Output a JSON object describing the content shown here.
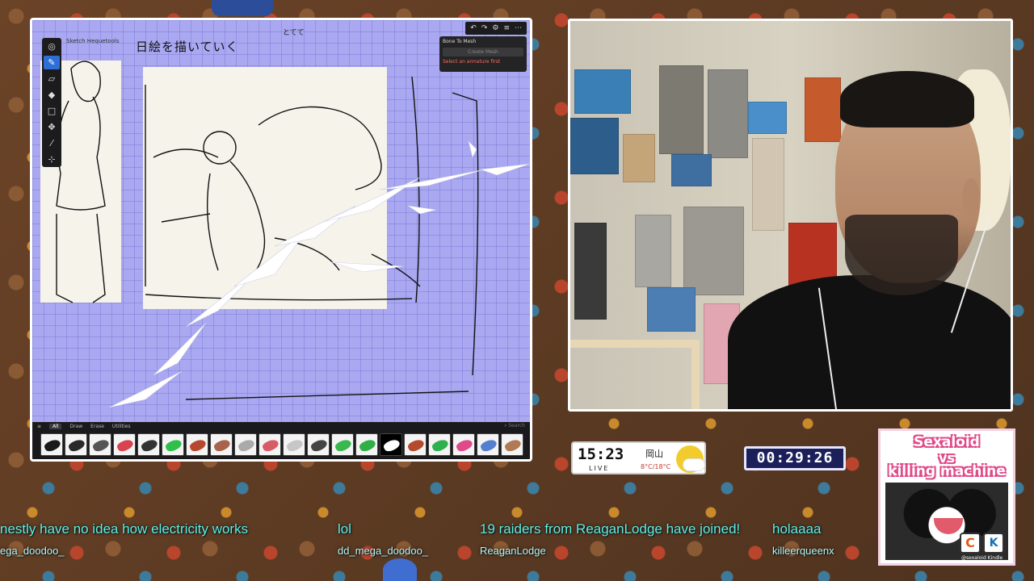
{
  "art_app": {
    "handwritten_note": "日絵を描いていく",
    "handwritten_small": "とてて",
    "tool_hint": "Sketch Hequetools",
    "top_icons": [
      "undo-icon",
      "redo-icon",
      "settings-icon",
      "layers-icon",
      "more-icon"
    ],
    "bone_panel": {
      "title": "Bone To Mesh",
      "button": "Create Mesh",
      "warning": "Select an armature first"
    },
    "brush_tabs": [
      "All",
      "Draw",
      "Erase",
      "Utilities"
    ],
    "brush_tab_active": "All",
    "search_placeholder": "Search",
    "brushes": [
      {
        "name": "ink-brush",
        "color": "#1a1a1a"
      },
      {
        "name": "ink-brush-2",
        "color": "#2a2a2a"
      },
      {
        "name": "pencil-brush",
        "color": "#555555"
      },
      {
        "name": "red-brush",
        "color": "#d9434f"
      },
      {
        "name": "charcoal-brush",
        "color": "#333333"
      },
      {
        "name": "green-brush",
        "color": "#2fbf4a"
      },
      {
        "name": "rust-brush",
        "color": "#b5482e"
      },
      {
        "name": "brown-brush",
        "color": "#a8644a"
      },
      {
        "name": "grey-brush",
        "color": "#aaaaaa"
      },
      {
        "name": "pink-red-brush",
        "color": "#d95b68"
      },
      {
        "name": "light-brush",
        "color": "#c7c7c7"
      },
      {
        "name": "hatch-brush",
        "color": "#444444"
      },
      {
        "name": "green-brush-2",
        "color": "#39b84f"
      },
      {
        "name": "green-brush-3",
        "color": "#2faf46"
      },
      {
        "name": "splatter-brush",
        "color": "#ffffff"
      },
      {
        "name": "rust-brush-2",
        "color": "#b44a2e"
      },
      {
        "name": "green-brush-4",
        "color": "#2fb04e"
      },
      {
        "name": "pink-brush",
        "color": "#e04a8a"
      },
      {
        "name": "blue-brush",
        "color": "#5580d0"
      },
      {
        "name": "tan-brush",
        "color": "#b07a56"
      }
    ]
  },
  "clock": {
    "time": "15:23",
    "live": "LIVE",
    "city": "岡山",
    "temp_low": "8°C",
    "temp_sep": "/",
    "temp_high": "18°C",
    "weather_icon": "sun-cloud-icon"
  },
  "timer": "00:29:26",
  "promo": {
    "title_1": "Sexaloid",
    "vs": "vs",
    "title_2": "killing machine",
    "logo_c": "C",
    "logo_k": "K",
    "caption": "@sexaloid Kindle"
  },
  "chat": [
    {
      "text": "nestly have no idea how electricity works",
      "user": "ega_doodoo_"
    },
    {
      "text": "lol",
      "user": "dd_mega_doodoo_"
    },
    {
      "text": "19 raiders from ReaganLodge have joined!",
      "user": "ReaganLodge"
    },
    {
      "text": "holaaaa",
      "user": "killeerqueenx"
    }
  ]
}
